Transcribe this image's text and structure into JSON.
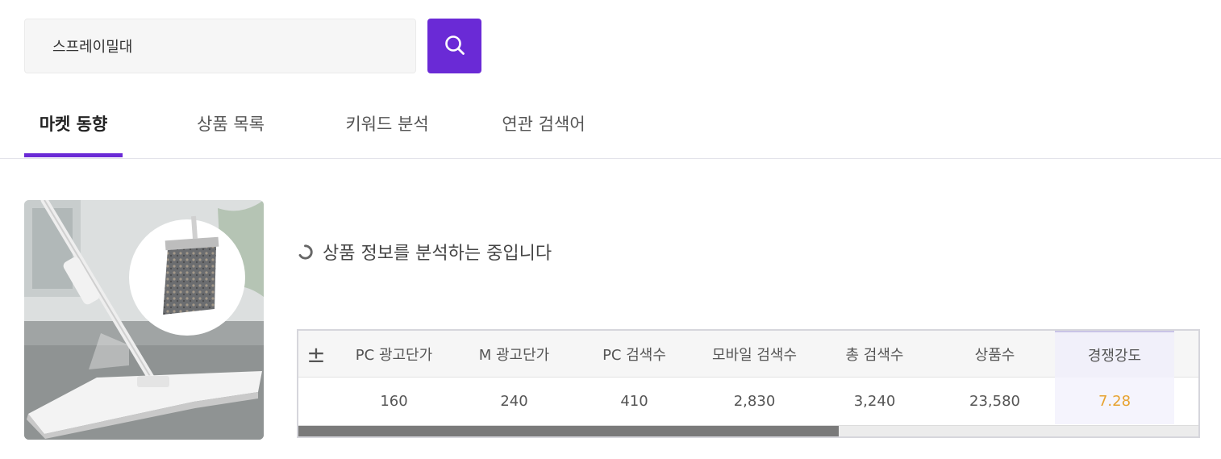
{
  "search": {
    "value": "스프레이밀대",
    "placeholder": "",
    "button_icon": "search-icon"
  },
  "tabs": [
    {
      "label": "마켓 동향",
      "active": true
    },
    {
      "label": "상품 목록",
      "active": false
    },
    {
      "label": "키워드 분석",
      "active": false
    },
    {
      "label": "연관 검색어",
      "active": false
    }
  ],
  "colors": {
    "accent": "#6a2ad6",
    "highlight_value": "#e7a230"
  },
  "product": {
    "image": "spray-mop-product-photo"
  },
  "status": {
    "icon": "loading-spinner-icon",
    "text": "상품 정보를 분석하는 중입니다"
  },
  "stats_table": {
    "toggle_symbol": "±",
    "headers": [
      "PC 광고단가",
      "M 광고단가",
      "PC 검색수",
      "모바일 검색수",
      "총 검색수",
      "상품수",
      "경쟁강도"
    ],
    "values": [
      "160",
      "240",
      "410",
      "2,830",
      "3,240",
      "23,580",
      "7.28"
    ],
    "highlighted_column": "경쟁강도",
    "scroll_position": 0.6
  }
}
